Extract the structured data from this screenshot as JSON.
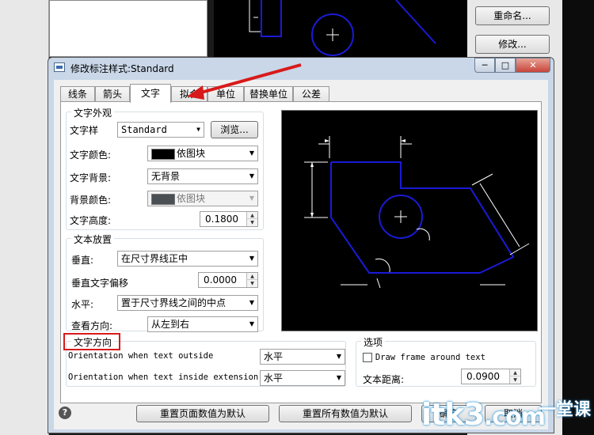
{
  "background": {
    "rename_button": "重命名...",
    "modify_button": "修改..."
  },
  "dialog": {
    "title": "修改标注样式:Standard",
    "controls": {
      "minimize": "─",
      "maximize": "□",
      "close": "✕"
    }
  },
  "tabs": [
    {
      "label": "线条"
    },
    {
      "label": "箭头"
    },
    {
      "label": "文字"
    },
    {
      "label": "拟合"
    },
    {
      "label": "单位"
    },
    {
      "label": "替换单位"
    },
    {
      "label": "公差"
    }
  ],
  "appearance": {
    "group_title": "文字外观",
    "style_label": "文字样",
    "style_value": "Standard",
    "browse_button": "浏览...",
    "color_label": "文字颜色:",
    "color_value": "依图块",
    "color_swatch": "#000000",
    "background_label": "文字背景:",
    "background_value": "无背景",
    "bg_color_label": "背景颜色:",
    "bg_color_value": "依图块",
    "bg_color_swatch": "#4a5054",
    "height_label": "文字高度:",
    "height_value": "0.1800"
  },
  "placement": {
    "group_title": "文本放置",
    "vertical_label": "垂直:",
    "vertical_value": "在尺寸界线正中",
    "offset_label": "垂直文字偏移",
    "offset_value": "0.0000",
    "horizontal_label": "水平:",
    "horizontal_value": "置于尺寸界线之间的中点",
    "view_label": "查看方向:",
    "view_value": "从左到右"
  },
  "orientation": {
    "group_title": "文字方向",
    "outside_label": "Orientation when text outside",
    "outside_value": "水平",
    "inside_label": "Orientation when text inside extension",
    "inside_value": "水平"
  },
  "options": {
    "group_title": "选项",
    "frame_label": "Draw frame around text",
    "frame_checked": false,
    "distance_label": "文本距离:",
    "distance_value": "0.0900"
  },
  "footer": {
    "reset_page": "重置页面数值为默认",
    "reset_all": "重置所有数值为默认",
    "ok": "确定",
    "cancel": "取消",
    "help": "?"
  },
  "watermark": {
    "text": "itk3",
    "suffix": ".com",
    "sub": "一堂课"
  },
  "colors": {
    "highlight_box": "#d81a1a",
    "preview_lines": "#1a1ad6"
  }
}
